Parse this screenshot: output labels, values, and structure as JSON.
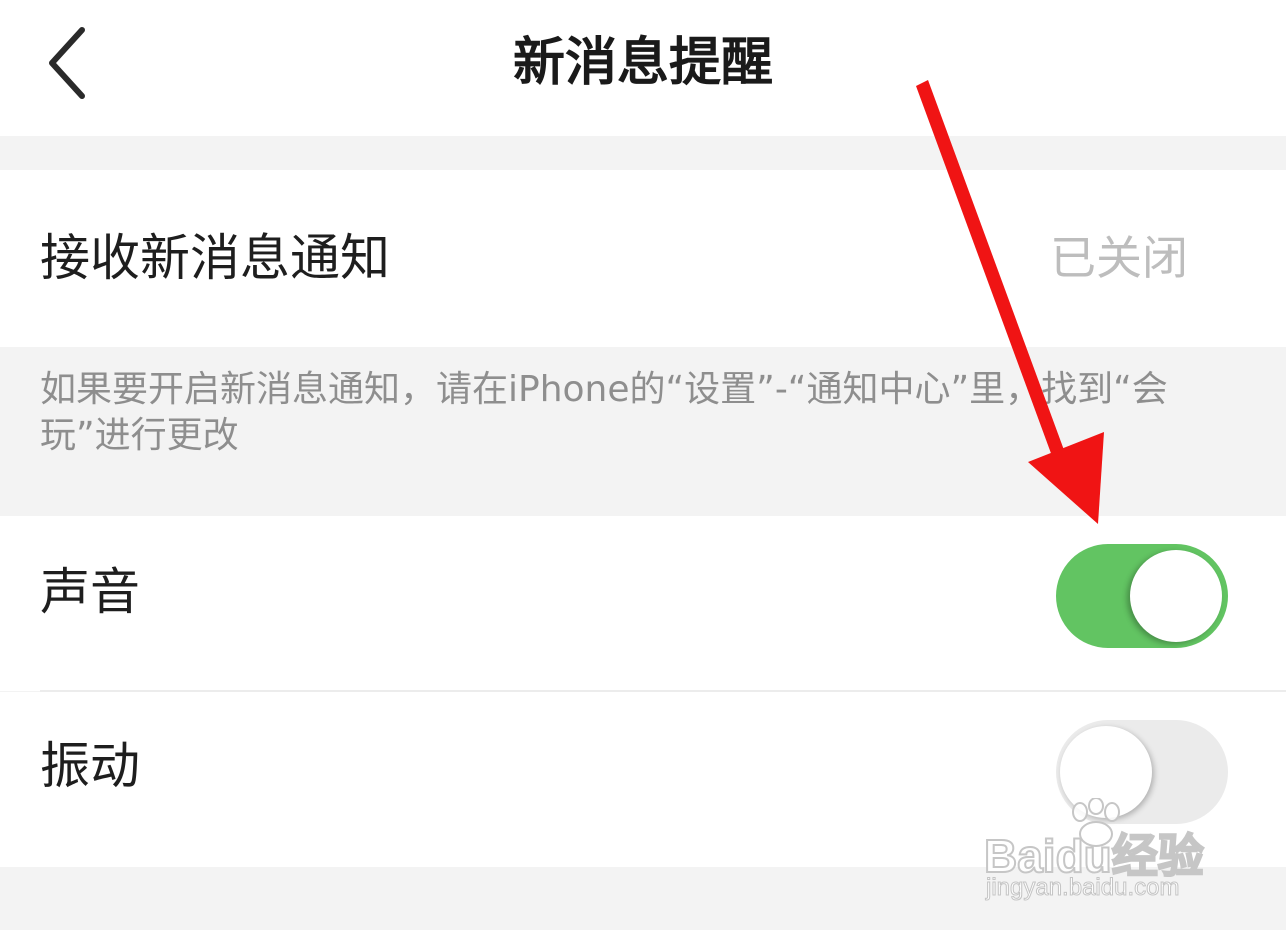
{
  "header": {
    "title": "新消息提醒",
    "back_icon": "chevron-left-icon"
  },
  "settings": {
    "receive_notifications": {
      "label": "接收新消息通知",
      "value": "已关闭"
    },
    "hint": "如果要开启新消息通知，请在iPhone的“设置”-“通知中心”里，找到“会玩”进行更改",
    "sound": {
      "label": "声音",
      "enabled": true
    },
    "vibrate": {
      "label": "振动",
      "enabled": false
    }
  },
  "colors": {
    "toggle_on": "#62c462",
    "toggle_off": "#ebebeb",
    "annotation_arrow": "#f01414",
    "page_background": "#f3f3f3"
  },
  "watermark": {
    "brand": "Baidu经验",
    "url": "jingyan.baidu.com"
  }
}
